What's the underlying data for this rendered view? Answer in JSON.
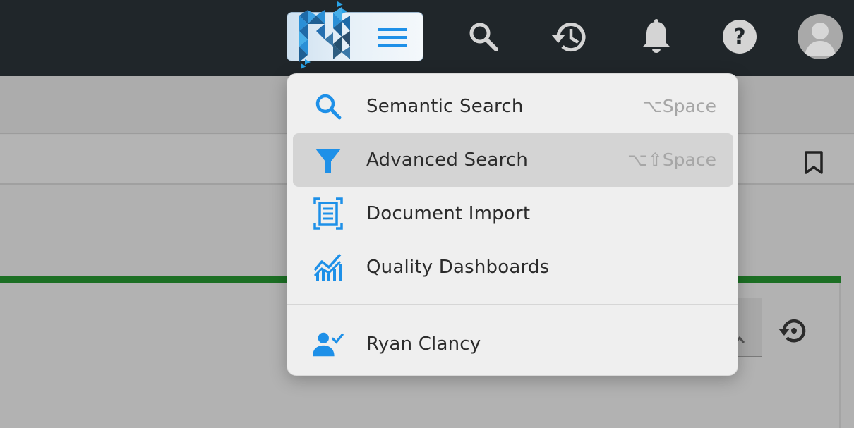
{
  "header": {
    "menu_icon": "hamburger-menu-icon",
    "icons": [
      "search-icon",
      "history-icon",
      "bell-icon",
      "help-icon",
      "avatar-icon"
    ]
  },
  "dropdown": {
    "items": [
      {
        "label": "Semantic Search",
        "shortcut": "⌥Space",
        "icon": "search-icon"
      },
      {
        "label": "Advanced Search",
        "shortcut": "⌥⇧Space",
        "icon": "filter-icon",
        "active": true
      },
      {
        "label": "Document Import",
        "shortcut": "",
        "icon": "document-scan-icon"
      },
      {
        "label": "Quality Dashboards",
        "shortcut": "",
        "icon": "chart-icon"
      }
    ],
    "user": {
      "label": "Ryan Clancy",
      "icon": "user-check-icon"
    }
  },
  "colors": {
    "topbar": "#20262a",
    "accent": "#1e90e8",
    "green_bar": "#1c6f24",
    "menu_bg": "#efefef",
    "active_bg": "#d4d4d4"
  }
}
